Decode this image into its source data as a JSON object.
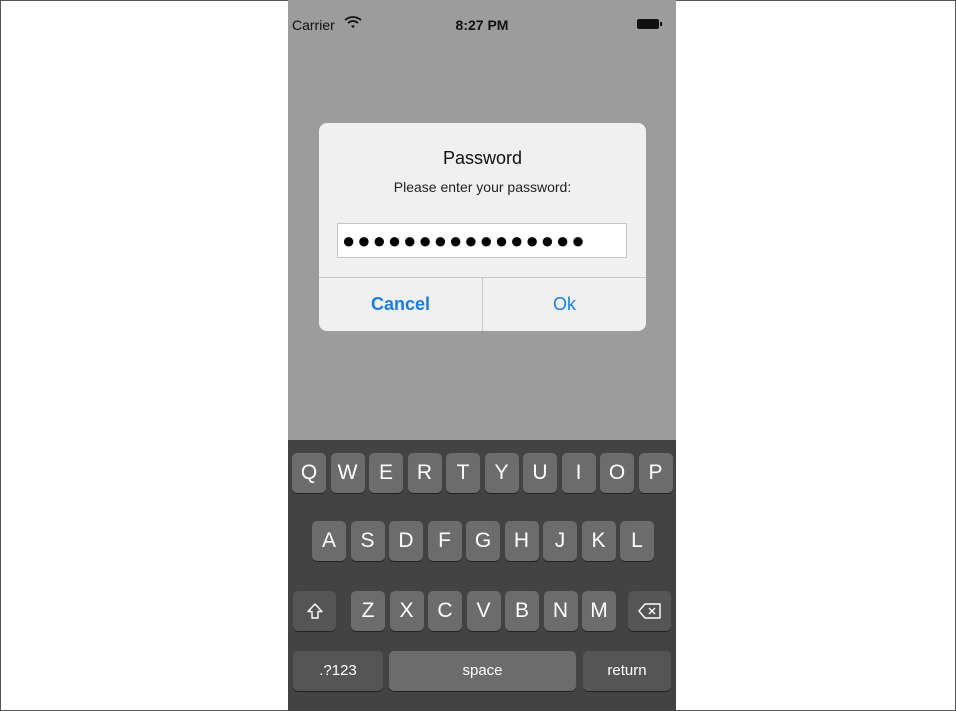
{
  "status_bar": {
    "carrier": "Carrier",
    "time": "8:27 PM"
  },
  "alert": {
    "title": "Password",
    "message": "Please enter your password:",
    "password_value": "●●●●●●●●●●●●●●●●",
    "cancel_label": "Cancel",
    "ok_label": "Ok"
  },
  "keyboard": {
    "row1": [
      "Q",
      "W",
      "E",
      "R",
      "T",
      "Y",
      "U",
      "I",
      "O",
      "P"
    ],
    "row2": [
      "A",
      "S",
      "D",
      "F",
      "G",
      "H",
      "J",
      "K",
      "L"
    ],
    "row3": [
      "Z",
      "X",
      "C",
      "V",
      "B",
      "N",
      "M"
    ],
    "numbers_label": ".?123",
    "space_label": "space",
    "return_label": "return",
    "shift_icon": "shift-icon",
    "delete_icon": "delete-icon"
  },
  "colors": {
    "accent": "#1a7de0",
    "dim_background": "#9c9c9c",
    "keyboard_bg": "#434343"
  }
}
